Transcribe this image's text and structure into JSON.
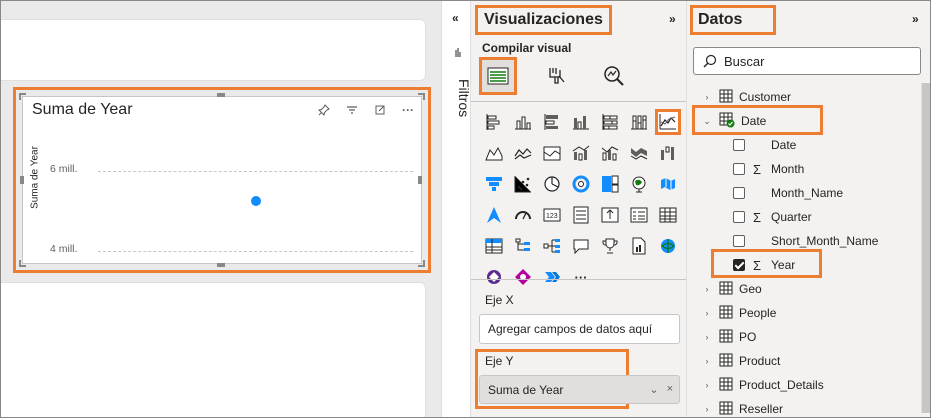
{
  "canvas": {
    "visual": {
      "title": "Suma de Year",
      "y_axis_title": "Suma de Year",
      "header_icons": [
        "pin-icon",
        "filter-icon",
        "focus-mode-icon",
        "more-options-icon"
      ],
      "more_glyph": "···"
    }
  },
  "chart_data": {
    "type": "scatter",
    "title": "Suma de Year",
    "xlabel": "",
    "ylabel": "Suma de Year",
    "y_ticks": [
      "6 mill.",
      "4 mill."
    ],
    "ylim": [
      4000000,
      6000000
    ],
    "grid": true,
    "points": [
      {
        "y": 5250000
      }
    ],
    "series_color": "#118dff"
  },
  "filters_pane": {
    "collapse_glyph": "«",
    "label": "Filtros"
  },
  "viz_pane": {
    "title": "Visualizaciones",
    "expand_glyph": "»",
    "build_label": "Compilar visual",
    "more_visuals_glyph": "···",
    "wells": {
      "x_label": "Eje X",
      "x_placeholder": "Agregar campos de datos aquí",
      "y_label": "Eje Y",
      "y_field": "Suma de Year",
      "y_field_chevron": "⌄",
      "y_field_remove": "×"
    }
  },
  "data_pane": {
    "title": "Datos",
    "expand_glyph": "»",
    "search_placeholder": "Buscar",
    "tables": {
      "customer": "Customer",
      "date": "Date",
      "geo": "Geo",
      "people": "People",
      "po": "PO",
      "product": "Product",
      "product_details": "Product_Details",
      "reseller": "Reseller"
    },
    "date_fields": {
      "date": "Date",
      "month": "Month",
      "month_name": "Month_Name",
      "quarter": "Quarter",
      "short_month_name": "Short_Month_Name",
      "year": "Year"
    },
    "expanded_glyph": "⌄",
    "collapsed_glyph": "›",
    "sigma_glyph": "Σ"
  },
  "colors": {
    "highlight": "#ed7d31",
    "accent_blue": "#118dff",
    "pane_background": "#f3f2f1",
    "canvas_background": "#eaeaea"
  }
}
